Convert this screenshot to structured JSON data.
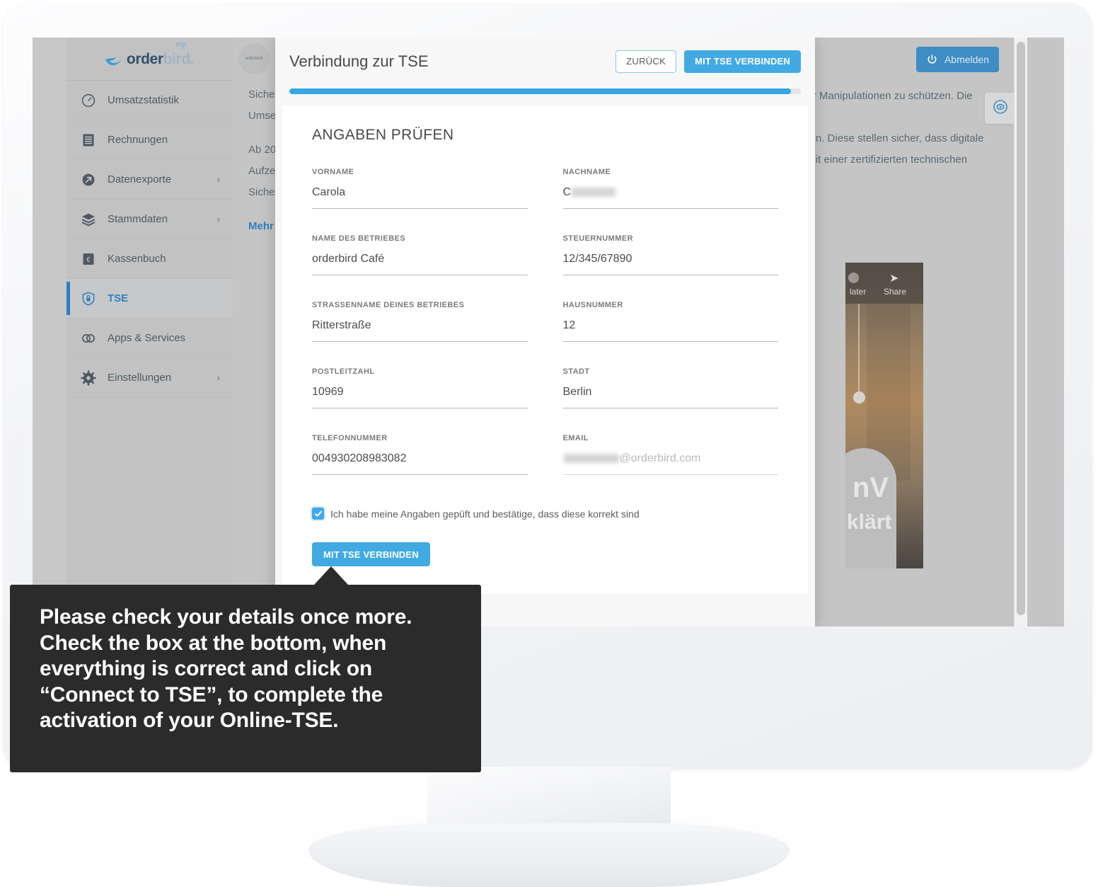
{
  "app": {
    "brand": {
      "order": "order",
      "bird": "bird.",
      "my": "my."
    },
    "sidebar": {
      "items": [
        {
          "label": "Umsatzstatistik",
          "icon": "speedometer-icon",
          "chevron": "",
          "active": false
        },
        {
          "label": "Rechnungen",
          "icon": "receipt-icon",
          "chevron": "",
          "active": false
        },
        {
          "label": "Datenexporte",
          "icon": "export-arrow-icon",
          "chevron": "›",
          "active": false
        },
        {
          "label": "Stammdaten",
          "icon": "layers-icon",
          "chevron": "›",
          "active": false
        },
        {
          "label": "Kassenbuch",
          "icon": "cashbook-euro-icon",
          "chevron": "",
          "active": false
        },
        {
          "label": "TSE",
          "icon": "shield-lock-icon",
          "chevron": "",
          "active": true
        },
        {
          "label": "Apps & Services",
          "icon": "rings-icon",
          "chevron": "",
          "active": false
        },
        {
          "label": "Einstellungen",
          "icon": "gear-icon",
          "chevron": "›",
          "active": false
        }
      ]
    },
    "topbar": {
      "logout_label": "Abmelden",
      "mini_logo": "orderbird",
      "help_icon": "lifebuoy-icon"
    },
    "background_text": {
      "line1": "Siche",
      "line2": "Umse",
      "line3": "Ab 20",
      "line4": "Aufze",
      "line5": "Siche",
      "link": "Mehr",
      "right1": "en vor Manipulationen zu schützen. Die",
      "right2": "werden. Diese stellen sicher, dass digitale",
      "right3": "sen mit einer zertifizierten technischen"
    },
    "video": {
      "later": "later",
      "share": "Share",
      "title_top": "nV",
      "title_bottom": "klärt"
    }
  },
  "modal": {
    "title": "Verbindung zur TSE",
    "back_label": "ZURÜCK",
    "connect_label": "MIT TSE VERBINDEN",
    "progress_percent": 98,
    "section_title": "ANGABEN PRÜFEN",
    "fields": [
      {
        "label": "VORNAME",
        "value": "Carola",
        "redacted": false,
        "light": false
      },
      {
        "label": "NACHNAME",
        "value": "C",
        "redacted": true,
        "redact_width": 62,
        "light": false
      },
      {
        "label": "NAME DES BETRIEBES",
        "value": "orderbird Café",
        "redacted": false,
        "light": false
      },
      {
        "label": "STEUERNUMMER",
        "value": "12/345/67890",
        "redacted": false,
        "light": false
      },
      {
        "label": "STRASSENNAME DEINES BETRIEBES",
        "value": "Ritterstraße",
        "redacted": false,
        "light": false
      },
      {
        "label": "HAUSNUMMER",
        "value": "12",
        "redacted": false,
        "light": false
      },
      {
        "label": "POSTLEITZAHL",
        "value": "10969",
        "redacted": false,
        "light": false
      },
      {
        "label": "STADT",
        "value": "Berlin",
        "redacted": false,
        "light": false
      },
      {
        "label": "TELEFONNUMMER",
        "value": "004930208983082",
        "redacted": false,
        "light": false
      },
      {
        "label": "EMAIL",
        "value": "@orderbird.com",
        "redacted": true,
        "redact_width": 78,
        "redact_before": true,
        "light": true
      }
    ],
    "checkbox": {
      "label": "Ich habe meine Angaben gepüft und bestätige, dass diese korrekt sind",
      "checked": true
    },
    "submit_label": "MIT TSE VERBINDEN"
  },
  "callout": {
    "text": "Please check your details once more. Check the box at the bottom, when everything is correct and click on “Connect to TSE”, to complete the activation of your Online-TSE."
  },
  "colors": {
    "accent_blue": "#41aae2",
    "progress_blue": "#36a6e4",
    "logout_blue": "#3e8dc4",
    "callout_bg": "#2b2b2b",
    "sidebar_bg": "#c2c2c2"
  }
}
